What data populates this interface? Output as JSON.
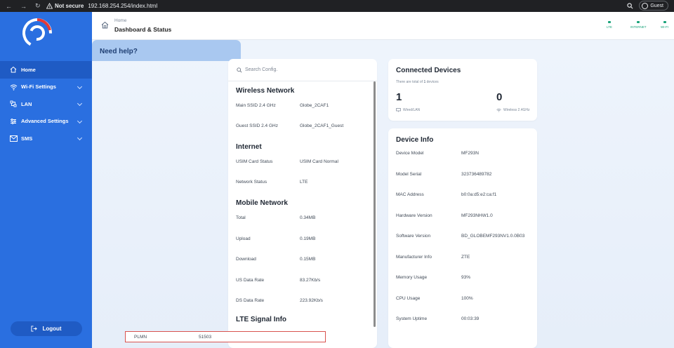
{
  "browser": {
    "security": "Not secure",
    "url": "192.168.254.254/index.html",
    "profile": "Guest"
  },
  "sidebar": {
    "items": [
      {
        "label": "Home",
        "icon": "home-icon"
      },
      {
        "label": "Wi-Fi Settings",
        "icon": "wifi-icon"
      },
      {
        "label": "LAN",
        "icon": "lan-icon"
      },
      {
        "label": "Advanced Settings",
        "icon": "sliders-icon"
      },
      {
        "label": "SMS",
        "icon": "mail-icon"
      }
    ],
    "logout": "Logout"
  },
  "header": {
    "breadcrumb": "Home",
    "title": "Dashboard & Status",
    "indicators": [
      "LTE",
      "INTERNET",
      "WI-FI"
    ]
  },
  "config": {
    "search_placeholder": "Search Config.",
    "wireless": {
      "title": "Wireless Network",
      "rows": [
        {
          "label": "Main SSID 2.4 GHz",
          "value": "Globe_2CAF1"
        },
        {
          "label": "Guest SSID 2.4 GHz",
          "value": "Globe_2CAF1_Guest"
        }
      ]
    },
    "internet": {
      "title": "Internet",
      "rows": [
        {
          "label": "USIM Card Status",
          "value": "USIM Card Normal"
        },
        {
          "label": "Network Status",
          "value": "LTE"
        }
      ]
    },
    "mobile": {
      "title": "Mobile Network",
      "rows": [
        {
          "label": "Total",
          "value": "0.34MB"
        },
        {
          "label": "Upload",
          "value": "0.19MB"
        },
        {
          "label": "Download",
          "value": "0.15MB"
        },
        {
          "label": "US Data Rate",
          "value": "83.27Kb/s"
        },
        {
          "label": "DS Data Rate",
          "value": "223.92Kb/s"
        }
      ]
    },
    "lte": {
      "title": "LTE Signal Info",
      "plmn_label": "PLMN",
      "plmn_value": "51503"
    }
  },
  "connected": {
    "title": "Connected Devices",
    "note_prefix": "There are total of",
    "note_count": "1",
    "note_suffix": "devices",
    "wired_count": "1",
    "wired_label": "Wired/LAN",
    "wireless_count": "0",
    "wireless_label": "Wireless 2.4GHz"
  },
  "device": {
    "title": "Device Info",
    "rows": [
      {
        "label": "Device Model",
        "value": "MF293N"
      },
      {
        "label": "Model Serial",
        "value": "323736489782"
      },
      {
        "label": "MAC Address",
        "value": "b0:0a:d5:e2:ca:f1"
      },
      {
        "label": "Hardware Version",
        "value": "MF293NHW1.0"
      },
      {
        "label": "Software Version",
        "value": "BD_GLOBEMF293NV1.0.0B03"
      },
      {
        "label": "Manufacturer Info",
        "value": "ZTE"
      },
      {
        "label": "Memory Usage",
        "value": "93%"
      },
      {
        "label": "CPU Usage",
        "value": "100%"
      },
      {
        "label": "System Uptime",
        "value": "00:03:39"
      }
    ]
  },
  "help": {
    "title": "Need help?"
  },
  "colors": {
    "sidebar": "#2a6fe0",
    "accent_green": "#1aa37a",
    "highlight_border": "#d9534f"
  }
}
